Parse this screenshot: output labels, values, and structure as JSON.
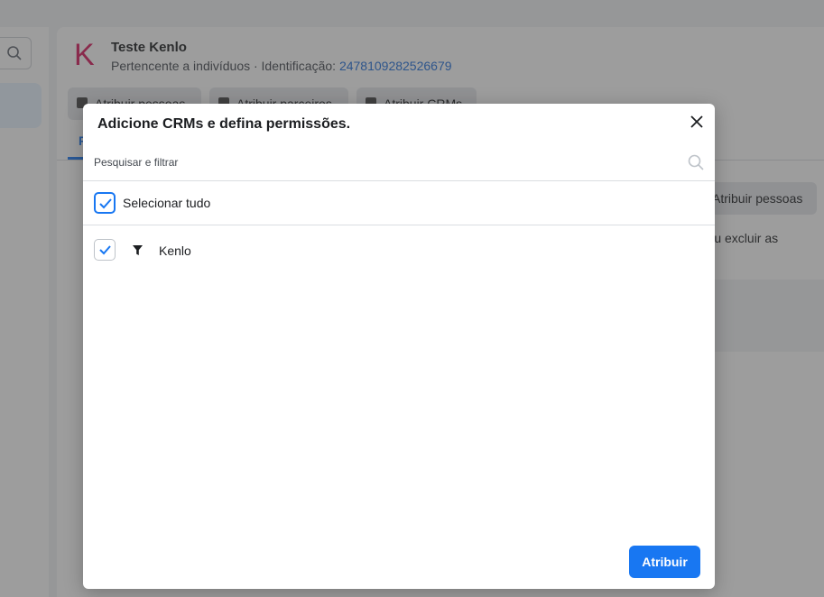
{
  "background": {
    "account": {
      "logo_letter": "K",
      "name": "Teste Kenlo",
      "subtitle_prefix": "Pertencente a indivíduos · Identificação: ",
      "id": "2478109282526679"
    },
    "action_buttons": [
      {
        "label": "Atribuir pessoas"
      },
      {
        "label": "Atribuir parceiros"
      },
      {
        "label": "Atribuir CRMs"
      }
    ],
    "active_tab": "P",
    "right_button": "Atribuir pessoas",
    "right_text": "r ou excluir as"
  },
  "modal": {
    "title": "Adicione CRMs e defina permissões.",
    "search_placeholder": "Pesquisar e filtrar",
    "select_all": {
      "label": "Selecionar tudo",
      "checked": true
    },
    "items": [
      {
        "label": "Kenlo",
        "checked": true,
        "icon": "filter-icon"
      }
    ],
    "submit_label": "Atribuir"
  },
  "colors": {
    "accent": "#1877f2",
    "logo": "#d6195c",
    "link": "#216fdb"
  }
}
